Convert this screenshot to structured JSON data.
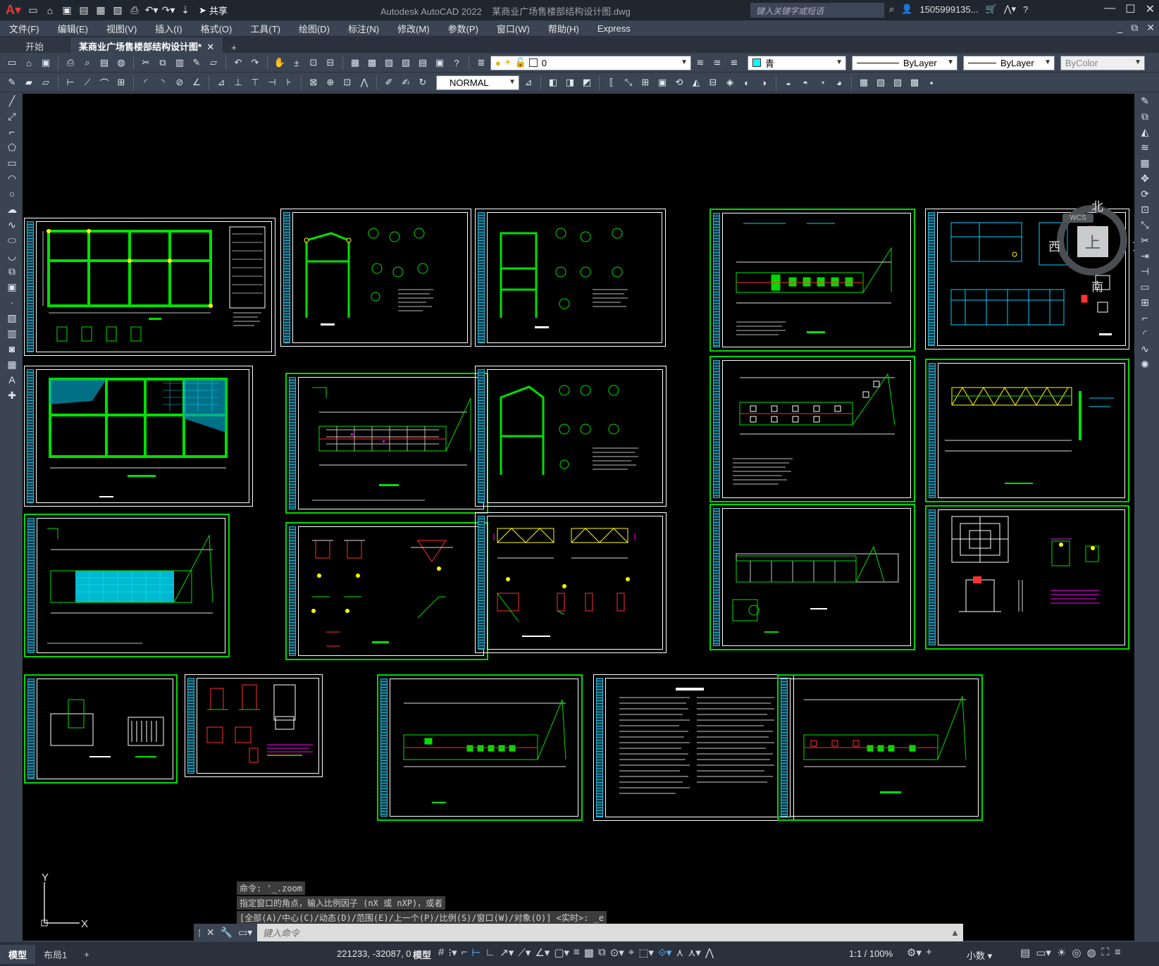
{
  "app": {
    "title": "Autodesk AutoCAD 2022",
    "document": "某商业广场售楼部结构设计图.dwg"
  },
  "titlebar": {
    "share_label": "共享",
    "search_placeholder": "键入关键字或短语",
    "user": "1505999135...",
    "help": "?"
  },
  "menu": [
    "文件(F)",
    "编辑(E)",
    "视图(V)",
    "插入(I)",
    "格式(O)",
    "工具(T)",
    "绘图(D)",
    "标注(N)",
    "修改(M)",
    "参数(P)",
    "窗口(W)",
    "帮助(H)",
    "Express"
  ],
  "tabs": {
    "start": "开始",
    "drawing": "某商业广场售楼部结构设计图*",
    "add": "+"
  },
  "properties": {
    "layer": "0",
    "color": "青",
    "color_hex": "#00ffff",
    "linetype": "ByLayer",
    "lineweight": "ByLayer",
    "plotstyle": "ByColor",
    "textstyle": "NORMAL"
  },
  "viewcube": {
    "north": "北",
    "south": "南",
    "east": "东",
    "west": "西",
    "face": "上",
    "wcs": "WCS"
  },
  "ucs": {
    "x": "X",
    "y": "Y"
  },
  "command": {
    "history": [
      "命令: '_.zoom",
      "指定窗口的角点，输入比例因子 (nX 或 nXP)，或者",
      "[全部(A)/中心(C)/动态(D)/范围(E)/上一个(P)/比例(S)/窗口(W)/对象(O)] <实时>: _e"
    ],
    "placeholder": "键入命令"
  },
  "statusbar": {
    "tabs": [
      "模型",
      "布局1"
    ],
    "add": "+",
    "coords": "221233, -32087, 0",
    "model": "模型",
    "scale": "1:1 / 100%",
    "units": "小数"
  },
  "colors": {
    "frame_green": "#00d800",
    "cyan": "#00e0ff",
    "yellow": "#ffff00",
    "magenta": "#ff00ff",
    "background": "#000000"
  }
}
